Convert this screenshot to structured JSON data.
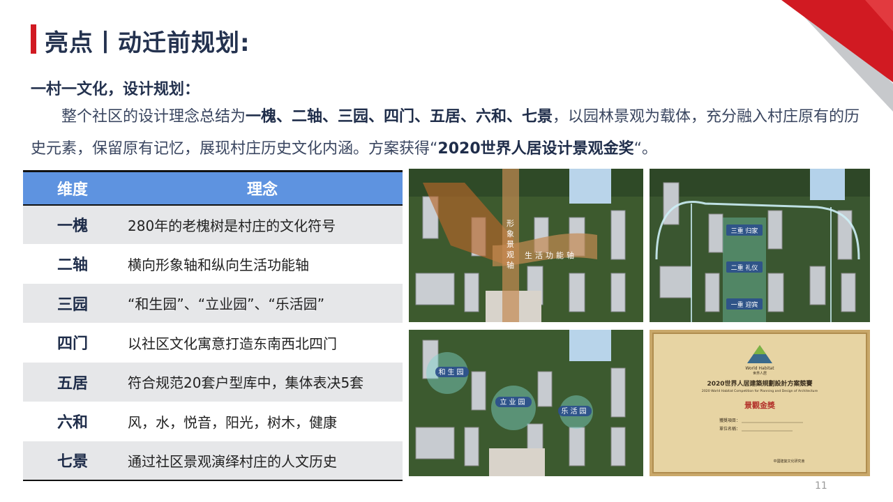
{
  "header": {
    "title": "亮点丨动迁前规划:"
  },
  "intro": {
    "subtitle": "一村一文化，设计规划：",
    "para_a": "整个社区的设计理念总结为",
    "para_bold": "一槐、二轴、三园、四门、五居、六和、七景",
    "para_b": "，以园林景观为载体，充分融入村庄原有的历史元素，保留原有记忆，展现村庄历史文化内涵。方案获得“",
    "para_award": "2020世界人居设计景观金奖",
    "para_end": "“。"
  },
  "table": {
    "headers": [
      "维度",
      "理念"
    ],
    "rows": [
      {
        "dim": "一槐",
        "idea": "280年的老槐树是村庄的文化符号"
      },
      {
        "dim": "二轴",
        "idea": "横向形象轴和纵向生活功能轴"
      },
      {
        "dim": "三园",
        "idea": "“和生园”、“立业园”、“乐活园”"
      },
      {
        "dim": "四门",
        "idea": "以社区文化寓意打造东南西北四门"
      },
      {
        "dim": "五居",
        "idea": "符合规范20套户型库中，集体表决5套"
      },
      {
        "dim": "六和",
        "idea": "风，水，悦音，阳光，树木，健康"
      },
      {
        "dim": "七景",
        "idea": "通过社区景观演绎村庄的人文历史"
      }
    ]
  },
  "images": {
    "axis_map": {
      "vertical_label": "形象景观轴",
      "horizontal_label": "生活功能轴"
    },
    "road_map": {
      "labels": [
        "三重 归家",
        "二重 礼仪",
        "一重 迎宾"
      ]
    },
    "garden_map": {
      "labels": [
        "和生园",
        "立业园",
        "乐活园"
      ]
    },
    "certificate": {
      "logo_text": "World Habitat",
      "logo_sub": "世界人居",
      "title": "2020世界人居建築規劃設計方案競賽",
      "subtitle": "2020 World Habitat Competition for Planning and Design of Architecture",
      "award": "景觀金獎",
      "project": "獲獎項目：",
      "unit": "單位名稱：",
      "footer": "中國建築文化研究會"
    }
  },
  "footer": {
    "page_number": "11"
  },
  "colors": {
    "accent_red": "#d11a22",
    "table_header_blue": "#5e93e0",
    "row_gray": "#e6e7e9"
  }
}
